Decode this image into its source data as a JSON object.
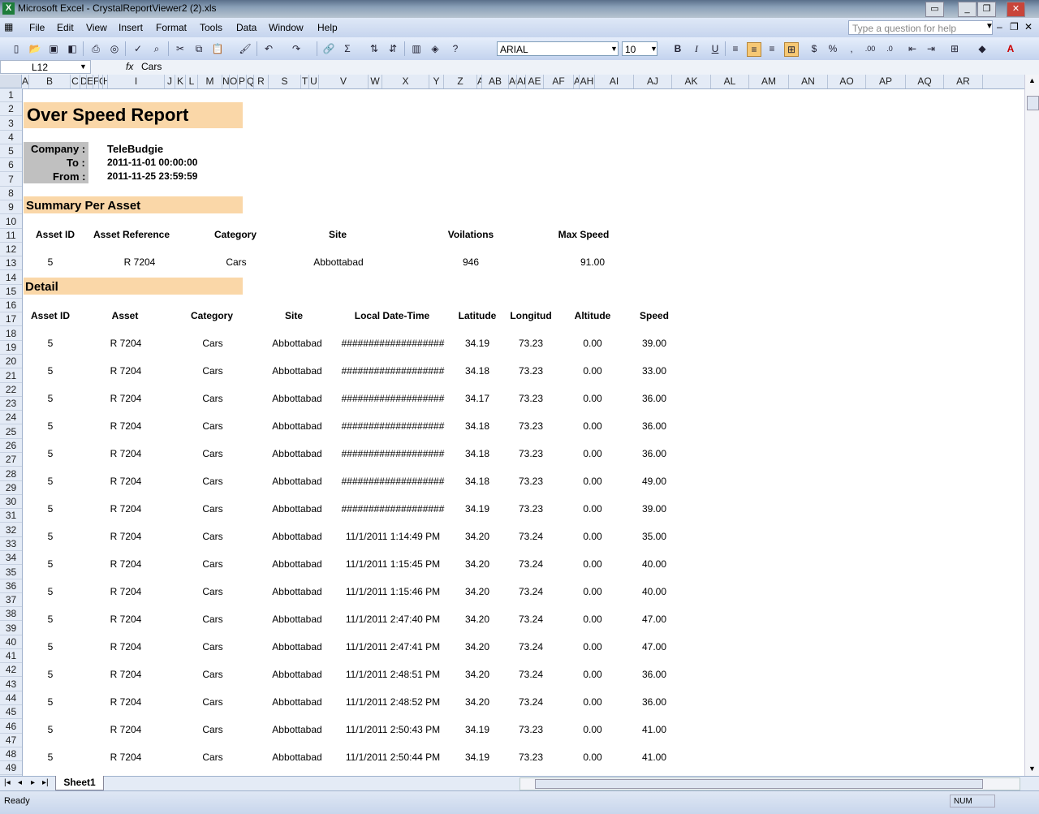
{
  "window": {
    "title": "Microsoft Excel - CrystalReportViewer2 (2).xls",
    "app_icon": "excel-icon"
  },
  "menu": {
    "items": [
      "File",
      "Edit",
      "View",
      "Insert",
      "Format",
      "Tools",
      "Data",
      "Window",
      "Help"
    ],
    "help_placeholder": "Type a question for help"
  },
  "toolbar": {
    "font": "ARIAL",
    "size": "10"
  },
  "formula_bar": {
    "cell_ref": "L12",
    "fx": "fx",
    "value": "Cars"
  },
  "columns": [
    "A",
    "B",
    "C",
    "D",
    "E",
    "F",
    "G",
    "H",
    "I",
    "J",
    "K",
    "L",
    "M",
    "N",
    "O",
    "P",
    "Q",
    "R",
    "S",
    "T",
    "U",
    "V",
    "W",
    "X",
    "Y",
    "Z",
    "AA",
    "AB",
    "AC",
    "AD",
    "AE",
    "AF",
    "AG",
    "AH",
    "AI",
    "AJ",
    "AK",
    "AL",
    "AM",
    "AN",
    "AO",
    "AP",
    "AQ",
    "AR"
  ],
  "report": {
    "title": "Over Speed Report",
    "company_label": "Company :",
    "company": "TeleBudgie",
    "to_label": "To :",
    "to": "2011-11-01 00:00:00",
    "from_label": "From :",
    "from": "2011-11-25 23:59:59",
    "summary_title": "Summary Per Asset",
    "summary_headers": [
      "Asset ID",
      "Asset Reference",
      "Category",
      "Site",
      "Voilations",
      "Max Speed"
    ],
    "summary_row": [
      "5",
      "R 7204",
      "Cars",
      "Abbottabad",
      "946",
      "91.00"
    ],
    "detail_title": "Detail",
    "detail_headers": [
      "Asset ID",
      "Asset",
      "Category",
      "Site",
      "Local Date-Time",
      "Latitude",
      "Longitud",
      "Altitude",
      "Speed"
    ],
    "detail_rows": [
      [
        "5",
        "R 7204",
        "Cars",
        "Abbottabad",
        "###################",
        "34.19",
        "73.23",
        "0.00",
        "39.00"
      ],
      [
        "5",
        "R 7204",
        "Cars",
        "Abbottabad",
        "###################",
        "34.18",
        "73.23",
        "0.00",
        "33.00"
      ],
      [
        "5",
        "R 7204",
        "Cars",
        "Abbottabad",
        "###################",
        "34.17",
        "73.23",
        "0.00",
        "36.00"
      ],
      [
        "5",
        "R 7204",
        "Cars",
        "Abbottabad",
        "###################",
        "34.18",
        "73.23",
        "0.00",
        "36.00"
      ],
      [
        "5",
        "R 7204",
        "Cars",
        "Abbottabad",
        "###################",
        "34.18",
        "73.23",
        "0.00",
        "36.00"
      ],
      [
        "5",
        "R 7204",
        "Cars",
        "Abbottabad",
        "###################",
        "34.18",
        "73.23",
        "0.00",
        "49.00"
      ],
      [
        "5",
        "R 7204",
        "Cars",
        "Abbottabad",
        "###################",
        "34.19",
        "73.23",
        "0.00",
        "39.00"
      ],
      [
        "5",
        "R 7204",
        "Cars",
        "Abbottabad",
        "11/1/2011  1:14:49 PM",
        "34.20",
        "73.24",
        "0.00",
        "35.00"
      ],
      [
        "5",
        "R 7204",
        "Cars",
        "Abbottabad",
        "11/1/2011  1:15:45 PM",
        "34.20",
        "73.24",
        "0.00",
        "40.00"
      ],
      [
        "5",
        "R 7204",
        "Cars",
        "Abbottabad",
        "11/1/2011  1:15:46 PM",
        "34.20",
        "73.24",
        "0.00",
        "40.00"
      ],
      [
        "5",
        "R 7204",
        "Cars",
        "Abbottabad",
        "11/1/2011  2:47:40 PM",
        "34.20",
        "73.24",
        "0.00",
        "47.00"
      ],
      [
        "5",
        "R 7204",
        "Cars",
        "Abbottabad",
        "11/1/2011  2:47:41 PM",
        "34.20",
        "73.24",
        "0.00",
        "47.00"
      ],
      [
        "5",
        "R 7204",
        "Cars",
        "Abbottabad",
        "11/1/2011  2:48:51 PM",
        "34.20",
        "73.24",
        "0.00",
        "36.00"
      ],
      [
        "5",
        "R 7204",
        "Cars",
        "Abbottabad",
        "11/1/2011  2:48:52 PM",
        "34.20",
        "73.24",
        "0.00",
        "36.00"
      ],
      [
        "5",
        "R 7204",
        "Cars",
        "Abbottabad",
        "11/1/2011  2:50:43 PM",
        "34.19",
        "73.23",
        "0.00",
        "41.00"
      ],
      [
        "5",
        "R 7204",
        "Cars",
        "Abbottabad",
        "11/1/2011  2:50:44 PM",
        "34.19",
        "73.23",
        "0.00",
        "41.00"
      ]
    ]
  },
  "sheet_tab": "Sheet1",
  "status": {
    "left": "Ready",
    "num": "NUM"
  }
}
